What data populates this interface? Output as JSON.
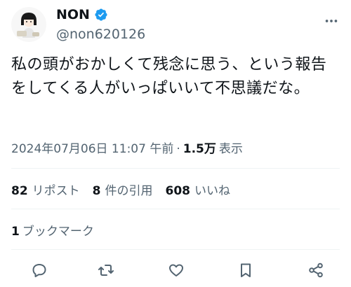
{
  "author": {
    "name": "NON",
    "handle": "@non620126",
    "verified": true,
    "verified_color": "#1d9bf0"
  },
  "tweet": {
    "text": "私の頭がおかしくて残念に思う、という報告をしてくる人がいっぱいいて不思議だな。",
    "time": "2024年07月06日 11:07 午前",
    "separator": "·",
    "views_count": "1.5万",
    "views_label": "表示"
  },
  "stats": {
    "reposts_count": "82",
    "reposts_label": "リポスト",
    "quotes_count": "8",
    "quotes_label": "件の引用",
    "likes_count": "608",
    "likes_label": "いいね",
    "bookmarks_count": "1",
    "bookmarks_label": "ブックマーク"
  },
  "actions": {
    "reply_icon": "reply-icon",
    "retweet_icon": "retweet-icon",
    "like_icon": "heart-icon",
    "bookmark_icon": "bookmark-icon",
    "share_icon": "share-icon"
  },
  "colors": {
    "text": "#0f1419",
    "secondary": "#536471",
    "divider": "#eff3f4"
  }
}
